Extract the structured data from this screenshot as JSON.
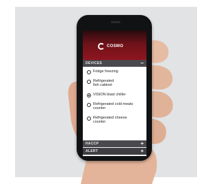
{
  "app": {
    "brand": "COSMO"
  },
  "sections": {
    "devices": {
      "title": "DEVICES",
      "toggle": "–"
    },
    "haccp": {
      "title": "HACCP",
      "toggle": "+"
    },
    "alert": {
      "title": "ALERT",
      "toggle": "+"
    }
  },
  "devices": [
    {
      "label": "Fridge freezing",
      "selected": false
    },
    {
      "label": "Refrigerated fish cabinet",
      "selected": false
    },
    {
      "label": "VISION blast chiller",
      "selected": true
    },
    {
      "label": "Refrigerated cold meats counter",
      "selected": false
    },
    {
      "label": "Refrigerated cheese counter",
      "selected": false
    }
  ],
  "colors": {
    "header_red": "#8f1520",
    "section_bar": "#4a4a4e",
    "background": "#e2e3e5"
  }
}
